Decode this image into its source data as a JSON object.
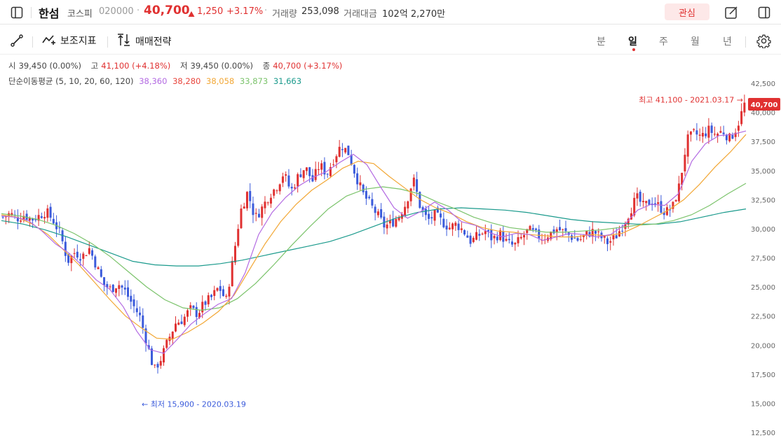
{
  "header": {
    "stock_name": "한섬",
    "market": "코스피",
    "code": "020000",
    "price": "40,700",
    "change": "1,250",
    "change_pct": "+3.17%",
    "volume_label": "거래량",
    "volume": "253,098",
    "amount_label": "거래대금",
    "amount": "102억 2,270만",
    "watch_label": "관심"
  },
  "toolbar": {
    "indicator_label": "보조지표",
    "strategy_label": "매매전략",
    "periods": [
      "분",
      "일",
      "주",
      "월",
      "년"
    ],
    "active_period": "일"
  },
  "ohlc": {
    "open_label": "시",
    "open": "39,450 (0.00%)",
    "high_label": "고",
    "high": "41,100 (+4.18%)",
    "low_label": "저",
    "low": "39,450 (0.00%)",
    "close_label": "종",
    "close": "40,700 (+3.17%)"
  },
  "ma": {
    "label": "단순이동평균 (5, 10, 20, 60, 120)",
    "values": [
      "38,360",
      "38,280",
      "38,058",
      "33,873",
      "31,663"
    ],
    "colors": [
      "#b36ae2",
      "#e8453c",
      "#f2a735",
      "#7bc36b",
      "#1a9a8c"
    ]
  },
  "colors": {
    "up": "#e03131",
    "down": "#3b5bdb",
    "accent": "#e03131"
  },
  "chart_data": {
    "type": "candlestick",
    "yticks": [
      "42,500",
      "40,000",
      "37,500",
      "35,000",
      "32,500",
      "30,000",
      "27,500",
      "25,000",
      "22,500",
      "20,000",
      "17,500",
      "15,000",
      "12,500"
    ],
    "ylim": [
      12500,
      42500
    ],
    "last_price_label": "40,700",
    "last_price": 40700,
    "high_annotation": "최고 41,100 - 2021.03.17 →",
    "high_value": 41100,
    "low_annotation": "← 최저 15,900 - 2020.03.19",
    "low_value": 15900,
    "close_path": [
      31000,
      31300,
      30900,
      31200,
      30800,
      31100,
      31500,
      30700,
      29500,
      27200,
      28000,
      27600,
      28300,
      26800,
      25200,
      24800,
      25300,
      24600,
      23500,
      22500,
      20200,
      17800,
      18900,
      20500,
      21900,
      22200,
      23100,
      22700,
      23600,
      24100,
      25000,
      23800,
      27500,
      31500,
      33200,
      30900,
      31800,
      32900,
      33600,
      34800,
      33200,
      34500,
      35300,
      34100,
      35500,
      34700,
      36100,
      37200,
      36500,
      34600,
      33000,
      32100,
      31200,
      30200,
      30500,
      31100,
      32200,
      34300,
      31800,
      30700,
      31200,
      30600,
      30100,
      30400,
      29800,
      28900,
      29400,
      29800,
      29100,
      29600,
      28800,
      28500,
      29200,
      29900,
      29500,
      29200,
      29600,
      30000,
      29700,
      29300,
      29000,
      29500,
      29800,
      29300,
      28800,
      29200,
      30200,
      31400,
      32700,
      31900,
      32400,
      32000,
      31400,
      31800,
      33800,
      37600,
      38200,
      37900,
      38500,
      38100,
      38400,
      37700,
      38800,
      40700
    ],
    "ma5_path": [
      31100,
      31000,
      30700,
      29800,
      28700,
      27900,
      26800,
      25600,
      24800,
      23300,
      21200,
      19600,
      19300,
      20500,
      21800,
      22700,
      23500,
      24000,
      26200,
      29500,
      31400,
      32700,
      33700,
      34400,
      34900,
      35700,
      36400,
      35500,
      33600,
      31800,
      30900,
      31500,
      32300,
      31600,
      30600,
      30300,
      29700,
      29300,
      29600,
      29500,
      29000,
      29300,
      29600,
      29500,
      29300,
      29500,
      30300,
      31600,
      32100,
      32000,
      33000,
      35800,
      37300,
      38000,
      38100,
      38400
    ],
    "ma20_path": [
      31200,
      31000,
      30400,
      29500,
      28200,
      26900,
      25400,
      23900,
      22500,
      21500,
      20600,
      20500,
      21100,
      21900,
      22900,
      24300,
      26500,
      28700,
      30600,
      32100,
      33300,
      34200,
      35200,
      35800,
      35600,
      34500,
      33500,
      32500,
      31800,
      31300,
      30600,
      30100,
      29800,
      29700,
      29500,
      29400,
      29300,
      29300,
      29500,
      29400,
      29600,
      30200,
      30900,
      31600,
      32500,
      33800,
      35300,
      36600,
      38100
    ],
    "ma60_path": [
      31300,
      31100,
      30800,
      30300,
      29600,
      28700,
      27600,
      26300,
      25000,
      23900,
      23200,
      23000,
      23200,
      24000,
      25300,
      26900,
      28600,
      30200,
      31700,
      32800,
      33400,
      33600,
      33400,
      33000,
      32300,
      31700,
      31000,
      30500,
      30100,
      29900,
      29700,
      29700,
      29800,
      29900,
      30100,
      30300,
      30400,
      30700,
      31200,
      32000,
      33000,
      33900
    ],
    "ma120_path": [
      30700,
      30400,
      29900,
      29300,
      28600,
      27900,
      27200,
      26900,
      26800,
      26800,
      27000,
      27300,
      27700,
      28100,
      28500,
      28900,
      29500,
      30200,
      30900,
      31400,
      31700,
      31800,
      31700,
      31600,
      31400,
      31100,
      30800,
      30600,
      30500,
      30400,
      30400,
      30600,
      31000,
      31400,
      31700
    ]
  }
}
